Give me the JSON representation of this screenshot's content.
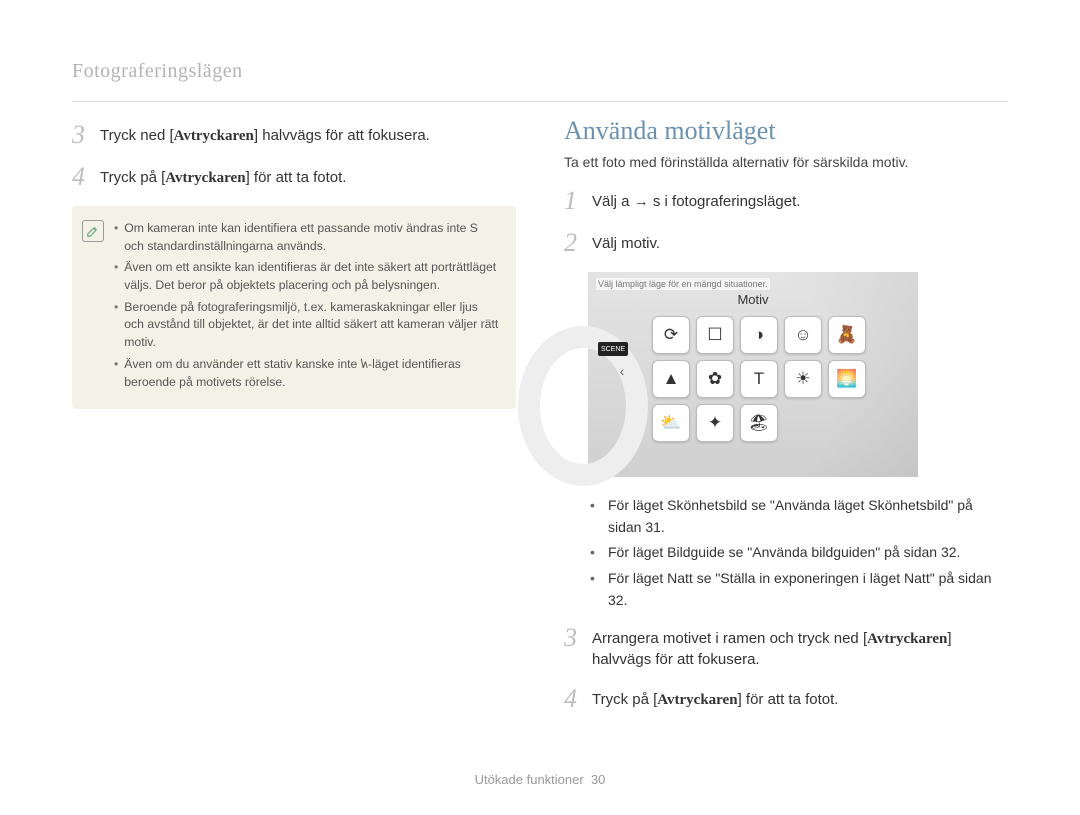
{
  "header": {
    "title": "Fotograferingslägen"
  },
  "left": {
    "steps": [
      {
        "num": "3",
        "text_a": "Tryck ned [",
        "bold": "Avtryckaren",
        "text_b": "] halvvägs för att fokusera."
      },
      {
        "num": "4",
        "text_a": "Tryck på [",
        "bold": "Avtryckaren",
        "text_b": "] för att ta fotot."
      }
    ],
    "notes": [
      "Om kameran inte kan identifiera ett passande motiv ändras inte S och standardinställningarna används.",
      "Även om ett ansikte kan identifieras är det inte säkert att porträttläget väljs. Det beror på objektets placering och på belysningen.",
      "Beroende på fotograferingsmiljö, t.ex. kameraskakningar eller ljus och avstånd till objektet, är det inte alltid säkert att kameran väljer rätt motiv.",
      "Även om du använder ett stativ kanske inte 𐑿-läget identifieras beroende på motivets rörelse."
    ],
    "note_icon": "info-pencil-icon"
  },
  "right": {
    "title": "Använda motivläget",
    "subtitle": "Ta ett foto med förinställda alternativ för särskilda motiv.",
    "steps12": [
      {
        "num": "1",
        "text": "Välj a → s i fotograferingsläget."
      },
      {
        "num": "2",
        "text": "Välj motiv."
      }
    ],
    "lcd": {
      "caption": "Välj lämpligt läge för en mängd situationer.",
      "panel_title": "Motiv",
      "scene_label": "SCENE",
      "icons": [
        "beauty-icon",
        "guide-icon",
        "night-icon",
        "portrait-icon",
        "children-icon",
        "landscape-icon",
        "closeup-icon",
        "text-icon",
        "sunset-icon",
        "dawn-icon",
        "backlight-icon",
        "fireworks-icon",
        "beach-snow-icon"
      ],
      "icon_glyphs": [
        "⟳",
        "☐",
        "◑",
        "☺",
        "🧸",
        "▲",
        "✿",
        "T",
        "☀",
        "🌅",
        "⛅",
        "✦",
        "🏖"
      ]
    },
    "sub_bullets": [
      "För läget Skönhetsbild se \"Använda läget Skönhetsbild\" på sidan 31.",
      "För läget Bildguide se \"Använda bildguiden\" på sidan 32.",
      "För läget Natt se \"Ställa in exponeringen i läget Natt\" på sidan 32."
    ],
    "steps34": [
      {
        "num": "3",
        "text_a": "Arrangera motivet i ramen och tryck ned [",
        "bold": "Avtryckaren",
        "text_b": "] halvvägs för att fokusera."
      },
      {
        "num": "4",
        "text_a": "Tryck på [",
        "bold": "Avtryckaren",
        "text_b": "] för att ta fotot."
      }
    ]
  },
  "footer": {
    "section": "Utökade funktioner",
    "page": "30"
  }
}
